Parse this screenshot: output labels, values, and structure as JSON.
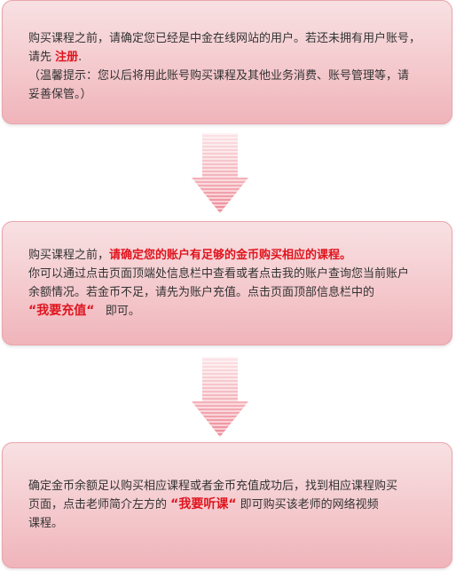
{
  "step1": {
    "line1": "购买课程之前，请确定您已经是中金在线网站的用户。若还未拥有用户账号，",
    "line2_prefix": "请先 ",
    "register_link": "注册",
    "line2_suffix": ".",
    "tip_line1": "（温馨提示：您以后将用此账号购买课程及其他业务消费、账号管理等，请",
    "tip_line2": "妥善保管。）"
  },
  "step2": {
    "line1_prefix": "购买课程之前，",
    "line1_highlight": "请确定您的账户有足够的金币购买相应的课程。",
    "line2": "你可以通过点击页面顶端处信息栏中查看或者点击我的账户查询您当前账户",
    "line3": "余额情况。若金币不足，请先为账户充值。点击页面顶部信息栏中的",
    "quote_label": "“我要充值“",
    "line4_suffix": "即可。"
  },
  "step3": {
    "line1": "确定金币余额足以购买相应课程或者金币充值成功后，找到相应课程购买",
    "line2_prefix": "页面，点击老师简介左方的 ",
    "quote_label": "“我要听课“",
    "line2_suffix": " 即可购买该老师的网络视频",
    "line3": "课程。"
  },
  "colors": {
    "highlight": "#e0141e",
    "box_top": "#f8e1e3",
    "box_bottom": "#efb4ba",
    "arrow": "#f19aa6"
  },
  "icons": {
    "arrow": "down-arrow-icon"
  }
}
